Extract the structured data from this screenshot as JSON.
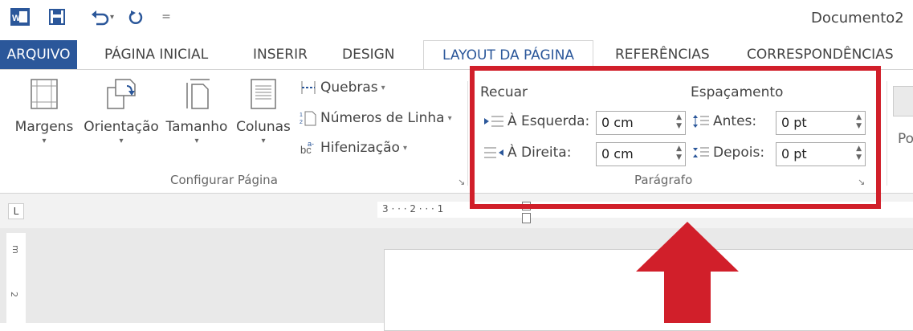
{
  "title_bar": {
    "doc_title": "Documento2"
  },
  "tabs": [
    "ARQUIVO",
    "PÁGINA INICIAL",
    "INSERIR",
    "DESIGN",
    "LAYOUT DA PÁGINA",
    "REFERÊNCIAS",
    "CORRESPONDÊNCIAS"
  ],
  "configurar": {
    "margens": "Margens",
    "orientacao": "Orientação",
    "tamanho": "Tamanho",
    "colunas": "Colunas",
    "quebras": "Quebras",
    "numeros": "Números de Linha",
    "hifenizacao": "Hifenização",
    "group_label": "Configurar Página"
  },
  "paragrafo": {
    "recuar": "Recuar",
    "espacamento": "Espaçamento",
    "esquerda_label": "À Esquerda:",
    "esquerda_value": "0 cm",
    "direita_label": "À Direita:",
    "direita_value": "0 cm",
    "antes_label": "Antes:",
    "antes_value": "0 pt",
    "depois_label": "Depois:",
    "depois_value": "0 pt",
    "group_label": "Parágrafo"
  },
  "partial_next_group": "Pos",
  "ruler": {
    "corner": "L",
    "numbers": "3 · · · 2 · · · 1"
  },
  "vruler_numbers": [
    "m",
    "2"
  ],
  "colors": {
    "accent": "#2b579a",
    "highlight": "#d11f2a"
  }
}
